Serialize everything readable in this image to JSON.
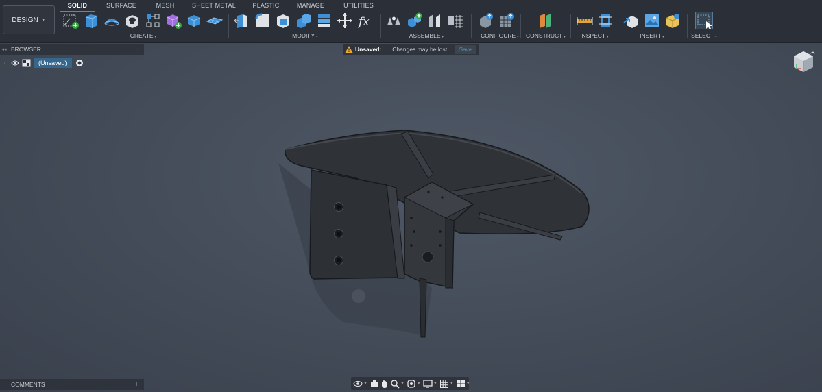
{
  "workspace": {
    "label": "DESIGN"
  },
  "tabs": [
    {
      "label": "SOLID",
      "active": true
    },
    {
      "label": "SURFACE",
      "active": false
    },
    {
      "label": "MESH",
      "active": false
    },
    {
      "label": "SHEET METAL",
      "active": false
    },
    {
      "label": "PLASTIC",
      "active": false
    },
    {
      "label": "MANAGE",
      "active": false
    },
    {
      "label": "UTILITIES",
      "active": false
    }
  ],
  "groups": {
    "create": {
      "label": "CREATE",
      "icons": [
        "create-sketch-icon",
        "extrude-icon",
        "revolve-icon",
        "hole-icon",
        "rectangular-pattern-icon",
        "create-form-icon",
        "box-icon",
        "mesh-plane-icon"
      ]
    },
    "modify": {
      "label": "MODIFY",
      "icons": [
        "press-pull-icon",
        "fillet-icon",
        "shell-icon",
        "combine-icon",
        "align-icon",
        "move-icon",
        "parameters-icon"
      ]
    },
    "assemble": {
      "label": "ASSEMBLE",
      "icons": [
        "joint-icon",
        "new-component-icon",
        "as-built-joint-icon",
        "joint-origin-icon"
      ]
    },
    "configure": {
      "label": "CONFIGURE",
      "icons": [
        "configure-icon",
        "table-icon"
      ]
    },
    "construct": {
      "label": "CONSTRUCT",
      "icons": [
        "offset-plane-icon"
      ]
    },
    "inspect": {
      "label": "INSPECT",
      "icons": [
        "measure-icon",
        "section-analysis-icon"
      ]
    },
    "insert": {
      "label": "INSERT",
      "icons": [
        "insert-derive-icon",
        "insert-image-icon",
        "insert-mcmaster-icon"
      ]
    },
    "select": {
      "label": "SELECT",
      "icons": [
        "select-window-icon"
      ]
    }
  },
  "browser": {
    "title": "BROWSER",
    "root_item": "(Unsaved)"
  },
  "banner": {
    "label": "Unsaved:",
    "message": "Changes may be lost",
    "save_label": "Save"
  },
  "comments": {
    "title": "COMMENTS"
  },
  "navbar": {
    "icons": [
      "orbit-icon",
      "look-at-icon",
      "pan-icon",
      "zoom-icon",
      "fit-icon",
      "display-settings-icon",
      "grid-icon",
      "viewports-icon"
    ]
  },
  "colors": {
    "accent": "#3a93d8",
    "toolbar": "#2b3038",
    "canvas": "#4a525e",
    "selection": "#37668c",
    "warning": "#f0a92b"
  }
}
